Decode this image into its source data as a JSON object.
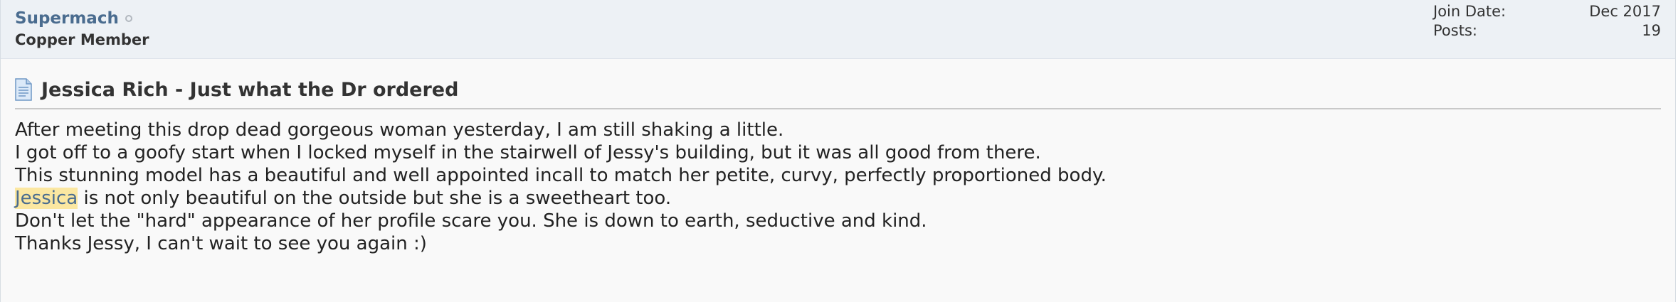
{
  "user": {
    "username": "Supermach",
    "status_icon": "offline-status-icon",
    "title": "Copper Member"
  },
  "stats": {
    "join_date_label": "Join Date:",
    "join_date_value": "Dec 2017",
    "posts_label": "Posts:",
    "posts_value": "19"
  },
  "post": {
    "icon": "document-icon",
    "title": "Jessica Rich - Just what the Dr ordered",
    "lines": [
      "After meeting this drop dead gorgeous woman yesterday, I am still shaking a little.",
      "I got off to a goofy start when I locked myself in the stairwell of Jessy's building, but it was all good from there.",
      "This stunning model has a beautiful and well appointed incall to match her petite, curvy, perfectly proportioned body.",
      {
        "highlight": "Jessica",
        "rest": " is not only beautiful on the outside but she is a sweetheart too."
      },
      "Don't let the \"hard\" appearance of her profile scare you. She is down to earth, seductive and kind.",
      "Thanks Jessy, I can't wait to see you again :)"
    ]
  },
  "colors": {
    "username": "#4a6c8f",
    "highlight_bg": "#fbe7a1",
    "header_bg": "#edf1f5",
    "body_bg": "#f9f9f9"
  }
}
